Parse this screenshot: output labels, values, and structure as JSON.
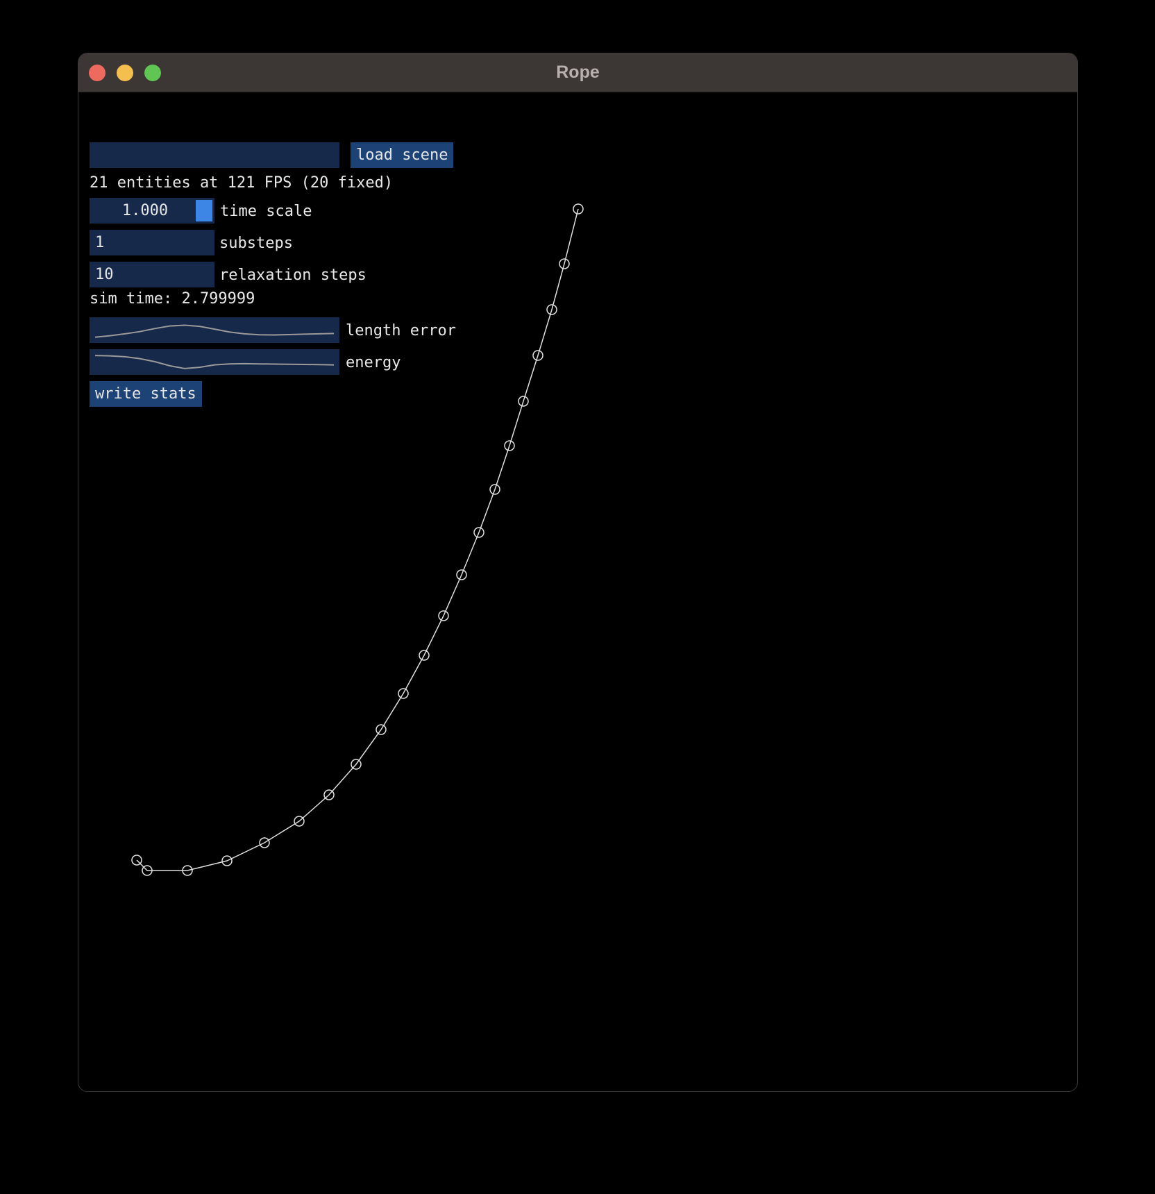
{
  "window": {
    "title": "Rope"
  },
  "panel": {
    "scene_path_value": "",
    "load_button_label": "load scene",
    "stats_text": "21 entities at 121 FPS (20 fixed)",
    "time_scale": {
      "value": "1.000",
      "label": "time scale",
      "slider_fraction": 1.0
    },
    "substeps": {
      "value": "1",
      "label": "substeps"
    },
    "relaxation_steps": {
      "value": "10",
      "label": "relaxation steps"
    },
    "sim_time_text": "sim time: 2.799999",
    "length_error_label": "length error",
    "energy_label": "energy",
    "write_stats_label": "write stats"
  },
  "colors": {
    "background": "#000000",
    "widget_bg": "#16294a",
    "button_bg": "#1d4275",
    "slider_grab": "#3d86e6",
    "rope": "#e0e0e0",
    "plot_line": "#9a9a9a"
  },
  "plots": {
    "length_error": [
      0.12,
      0.2,
      0.3,
      0.42,
      0.58,
      0.72,
      0.76,
      0.7,
      0.55,
      0.4,
      0.3,
      0.25,
      0.24,
      0.26,
      0.28,
      0.3,
      0.32
    ],
    "energy": [
      0.85,
      0.83,
      0.78,
      0.68,
      0.52,
      0.3,
      0.15,
      0.22,
      0.35,
      0.4,
      0.41,
      0.4,
      0.39,
      0.38,
      0.37,
      0.36,
      0.35
    ]
  },
  "rope": {
    "node_count": 21
  }
}
